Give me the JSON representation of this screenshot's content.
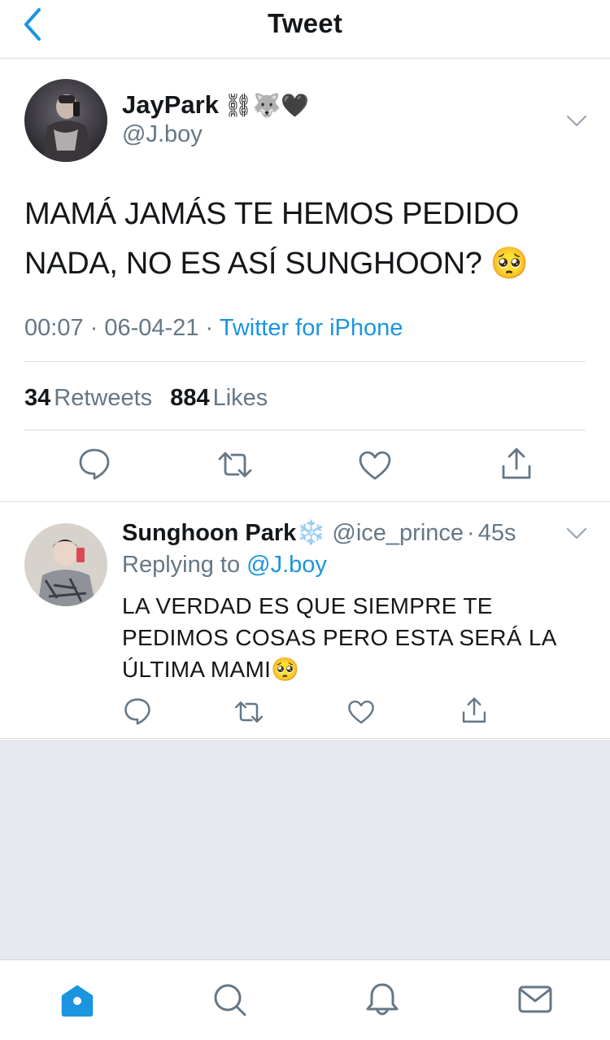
{
  "header": {
    "title": "Tweet"
  },
  "main_tweet": {
    "author_name": "JayPark",
    "author_emojis": "⛓🐺🖤",
    "author_handle": "@J.boy",
    "text": "MAMÁ JAMÁS TE HEMOS PEDIDO NADA, NO ES ASÍ SUNGHOON? 🥺",
    "time": "00:07",
    "date": "06-04-21",
    "source": "Twitter for iPhone",
    "retweets_count": "34",
    "retweets_label": "Retweets",
    "likes_count": "884",
    "likes_label": "Likes"
  },
  "reply": {
    "author_name": "Sunghoon Park❄️",
    "author_handle": "@ice_prince",
    "time": "45s",
    "replying_label": "Replying to",
    "replying_handle": "@J.boy",
    "text": "LA VERDAD ES QUE SIEMPRE TE PEDIMOS COSAS PERO ESTA SERÁ LA ÚLTIMA MAMI🥺"
  },
  "icons": {
    "back": "chevron-left-icon",
    "reply": "reply-icon",
    "retweet": "retweet-icon",
    "like": "heart-icon",
    "share": "share-icon",
    "home": "home-icon",
    "search": "search-icon",
    "notifications": "bell-icon",
    "messages": "mail-icon"
  },
  "colors": {
    "accent": "#1b95e0",
    "secondary_text": "#657786",
    "divider": "#d8dde3",
    "background_gray": "#e6e8ed"
  }
}
